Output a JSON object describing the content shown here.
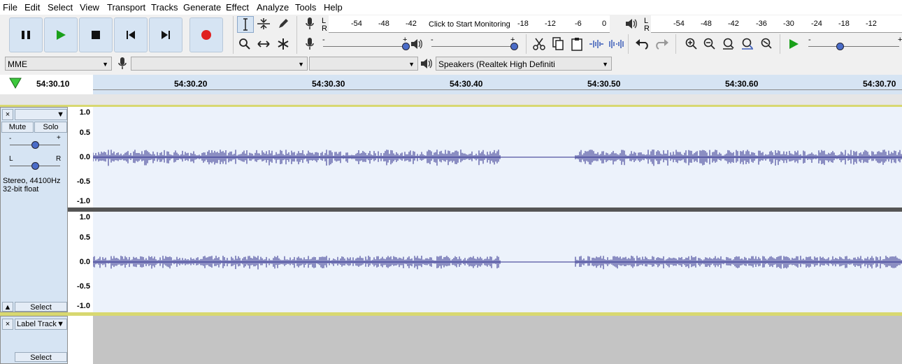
{
  "menu": [
    "File",
    "Edit",
    "Select",
    "View",
    "Transport",
    "Tracks",
    "Generate",
    "Effect",
    "Analyze",
    "Tools",
    "Help"
  ],
  "transport": {
    "pause": "pause-icon",
    "play": "play-icon",
    "stop": "stop-icon",
    "skip_start": "skip-start-icon",
    "skip_end": "skip-end-icon",
    "record": "record-icon"
  },
  "record_meter": {
    "ticks": [
      "-54",
      "-48",
      "-42",
      "-18",
      "-12",
      "-6",
      "0"
    ],
    "monitor_text": "Click to Start Monitoring",
    "L": "L",
    "R": "R"
  },
  "play_meter": {
    "ticks": [
      "-54",
      "-48",
      "-42",
      "-36",
      "-30",
      "-24",
      "-18",
      "-12"
    ],
    "L": "L",
    "R": "R"
  },
  "slider_minus": "-",
  "slider_plus": "+",
  "device": {
    "host": "MME",
    "rec_device": "",
    "rec_channels": "",
    "playback": "Speakers (Realtek High Definiti"
  },
  "ruler": {
    "start_label": "54:30.10",
    "ticks": [
      "54:30.20",
      "54:30.30",
      "54:30.40",
      "54:30.50",
      "54:30.60",
      "54:30.70"
    ]
  },
  "audio_track": {
    "close": "×",
    "name": "",
    "mute": "Mute",
    "solo": "Solo",
    "gain_minus": "-",
    "gain_plus": "+",
    "pan_L": "L",
    "pan_R": "R",
    "info_line1": "Stereo, 44100Hz",
    "info_line2": "32-bit float",
    "select": "Select",
    "scale": [
      "1.0",
      "0.5",
      "0.0",
      "-0.5",
      "-1.0"
    ]
  },
  "label_track": {
    "close": "×",
    "name": "Label Track",
    "select": "Select"
  },
  "colors": {
    "waveform": "#2a2a8a",
    "track_bg": "#ecf2fb",
    "panel": "#d6e4f3",
    "record": "#e02020",
    "play": "#1aa01a"
  }
}
